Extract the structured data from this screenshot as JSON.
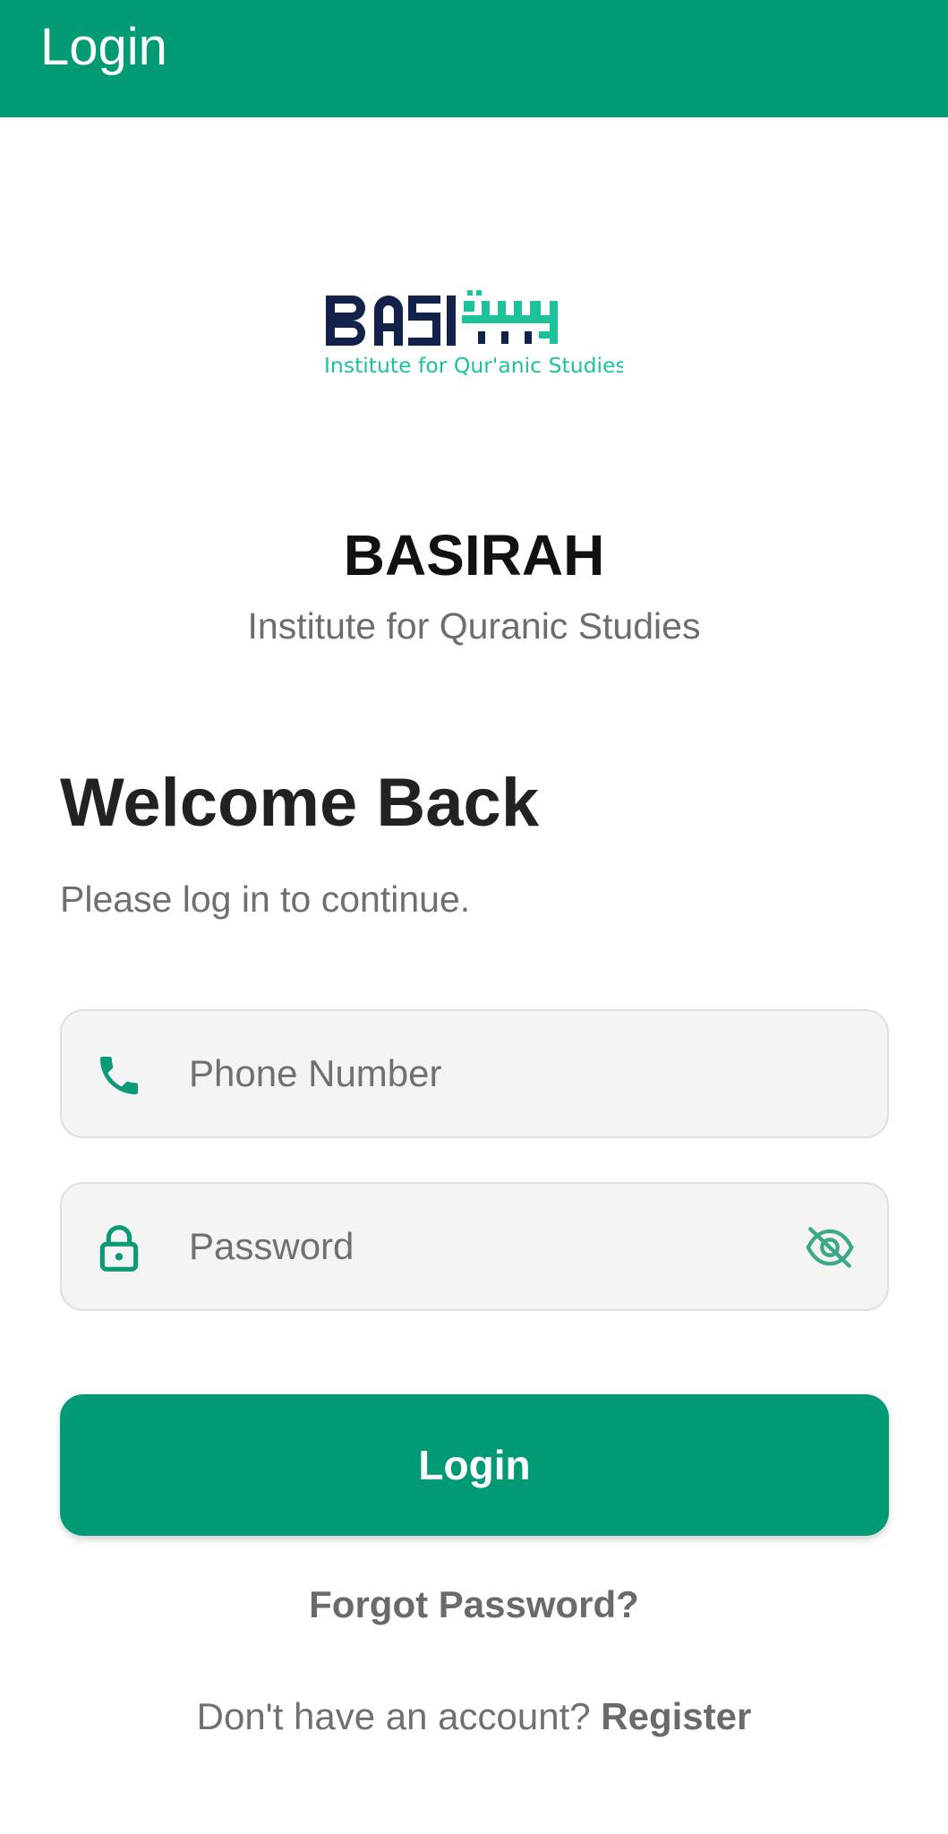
{
  "appbar": {
    "title": "Login",
    "background_color": "#009a75"
  },
  "logo": {
    "wordmark": "BASIRAH",
    "tagline": "Institute for Qur'anic Studies",
    "primary_color": "#13224a",
    "accent_color": "#1cc39a"
  },
  "brand": {
    "title": "BASIRAH",
    "subtitle": "Institute for Quranic Studies"
  },
  "welcome": {
    "heading": "Welcome Back",
    "subheading": "Please log in to continue."
  },
  "form": {
    "phone": {
      "placeholder": "Phone Number",
      "value": "",
      "icon": "phone-icon"
    },
    "password": {
      "placeholder": "Password",
      "value": "",
      "icon": "lock-icon",
      "toggle_icon": "visibility-off-icon"
    },
    "login_label": "Login",
    "forgot_label": "Forgot Password?",
    "register_prompt": "Don't have an account?",
    "register_label": "Register"
  },
  "colors": {
    "accent": "#009a75",
    "field_background": "#f4f4f4",
    "muted_text": "#707070"
  }
}
